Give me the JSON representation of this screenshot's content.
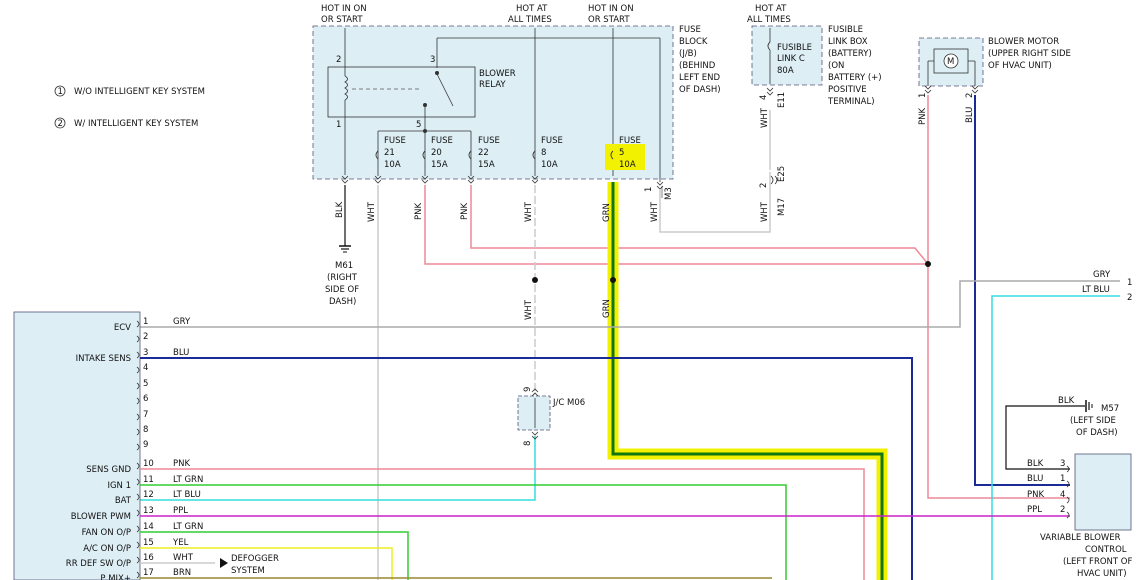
{
  "legend": [
    {
      "num": "1",
      "text": "W/O INTELLIGENT KEY SYSTEM"
    },
    {
      "num": "2",
      "text": "W/ INTELLIGENT KEY SYSTEM"
    }
  ],
  "power": {
    "hot_run_start_1": "HOT IN ON",
    "hot_run_start_2": "OR START",
    "hot_all_1": "HOT AT",
    "hot_all_2": "ALL TIMES",
    "hot_run2_1": "HOT IN ON",
    "hot_run2_2": "OR START",
    "hot_bat_1": "HOT AT",
    "hot_bat_2": "ALL TIMES"
  },
  "fuse_block": {
    "label": [
      "FUSE",
      "BLOCK",
      "(J/B)",
      "(BEHIND",
      "LEFT END",
      "OF DASH)"
    ]
  },
  "blower_relay": {
    "label": [
      "BLOWER",
      "RELAY"
    ],
    "pins": [
      "2",
      "3",
      "1",
      "5"
    ]
  },
  "fuses": [
    {
      "name": "FUSE",
      "num": "21",
      "amp": "10A"
    },
    {
      "name": "FUSE",
      "num": "20",
      "amp": "15A"
    },
    {
      "name": "FUSE",
      "num": "22",
      "amp": "15A"
    },
    {
      "name": "FUSE",
      "num": "8",
      "amp": "10A"
    },
    {
      "name": "FUSE",
      "num": "5",
      "amp": "10A"
    }
  ],
  "fusible_link": {
    "box_label": [
      "FUSIBLE",
      "LINK BOX",
      "(BATTERY)",
      "(ON",
      "BATTERY (+)",
      "POSITIVE",
      "TERMINAL)"
    ],
    "fuse": [
      "FUSIBLE",
      "LINK C",
      "80A"
    ],
    "connector_top": "E11",
    "pin_top": "4",
    "connector_bottom": "E25",
    "connector_bottom2": "M17",
    "pin_bottom": "2"
  },
  "blower_motor": {
    "label": [
      "BLOWER MOTOR",
      "(UPPER RIGHT SIDE",
      "OF HVAC UNIT)"
    ],
    "symbol": "M",
    "pins": [
      "1",
      "2"
    ]
  },
  "ground_m61": {
    "label": [
      "M61",
      "(RIGHT",
      "SIDE OF",
      "DASH)"
    ]
  },
  "ground_m57": {
    "label": [
      "M57",
      "(LEFT SIDE",
      "OF DASH)"
    ],
    "wire": "BLK"
  },
  "jc": {
    "label": "J/C M06",
    "pin_top": "9",
    "pin_bottom": "8"
  },
  "m3": {
    "connector": "M3",
    "pin": "1"
  },
  "wire_labels": {
    "blk": "BLK",
    "wht": "WHT",
    "pnk": "PNK",
    "grn": "GRN",
    "gry": "GRY",
    "ltblu": "LT BLU",
    "blu": "BLU"
  },
  "right_terminals": {
    "gry_pin": "1",
    "ltblu_pin": "2"
  },
  "ecu_pins": [
    {
      "pin": "1",
      "name": "ECV",
      "wire": "GRY"
    },
    {
      "pin": "2",
      "name": "",
      "wire": ""
    },
    {
      "pin": "3",
      "name": "INTAKE SENS",
      "wire": "BLU"
    },
    {
      "pin": "4",
      "name": "",
      "wire": ""
    },
    {
      "pin": "5",
      "name": "",
      "wire": ""
    },
    {
      "pin": "6",
      "name": "",
      "wire": ""
    },
    {
      "pin": "7",
      "name": "",
      "wire": ""
    },
    {
      "pin": "8",
      "name": "",
      "wire": ""
    },
    {
      "pin": "9",
      "name": "",
      "wire": ""
    },
    {
      "pin": "10",
      "name": "SENS GND",
      "wire": "PNK"
    },
    {
      "pin": "11",
      "name": "IGN 1",
      "wire": "LT GRN"
    },
    {
      "pin": "12",
      "name": "BAT",
      "wire": "LT BLU"
    },
    {
      "pin": "13",
      "name": "BLOWER PWM",
      "wire": "PPL"
    },
    {
      "pin": "14",
      "name": "FAN ON O/P",
      "wire": "LT GRN"
    },
    {
      "pin": "15",
      "name": "A/C ON O/P",
      "wire": "YEL"
    },
    {
      "pin": "16",
      "name": "RR DEF SW O/P",
      "wire": "WHT"
    },
    {
      "pin": "17",
      "name": "P MIX+",
      "wire": "BRN"
    }
  ],
  "defogger": [
    "DEFOGGER",
    "SYSTEM"
  ],
  "vbc": {
    "label": [
      "VARIABLE BLOWER",
      "CONTROL",
      "(LEFT FRONT OF",
      "HVAC UNIT)"
    ],
    "pins": [
      {
        "pin": "3",
        "wire": "BLK"
      },
      {
        "pin": "1",
        "wire": "BLU"
      },
      {
        "pin": "4",
        "wire": "PNK"
      },
      {
        "pin": "2",
        "wire": "PPL"
      }
    ]
  },
  "colors": {
    "pnk": "#ee8899",
    "blu": "#1a2a99",
    "gry": "#aaaaaa",
    "ltblu": "#33dddd",
    "ltgrn": "#33cc33",
    "ppl": "#cc22cc",
    "yel": "#eeee22",
    "brn": "#998833",
    "grn": "#117711",
    "highlight": "#f2f200",
    "box": "#ddeef5"
  }
}
